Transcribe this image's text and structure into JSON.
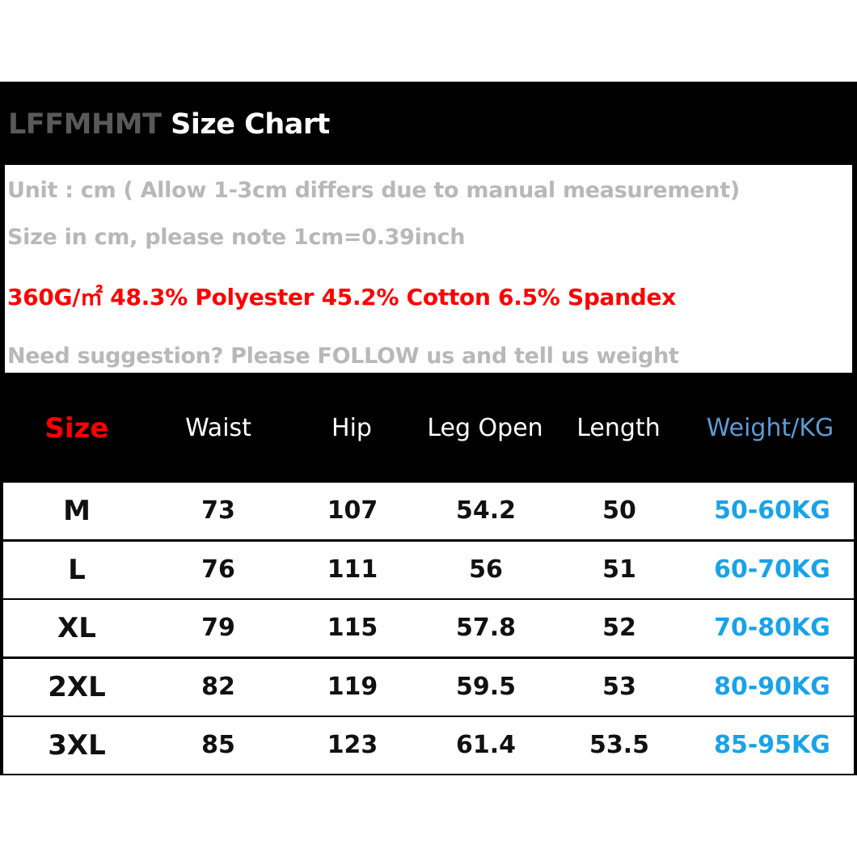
{
  "header": {
    "brand": "LFFMHMT",
    "title": "Size Chart"
  },
  "info": {
    "unit_note": "Unit : cm ( Allow 1-3cm differs due to manual measurement)",
    "conversion_note": "Size in cm, please note 1cm=0.39inch",
    "fabric_note": "360G/㎡ 48.3% Polyester 45.2% Cotton 6.5% Spandex",
    "suggestion_note": "Need suggestion? Please FOLLOW us and tell us weight"
  },
  "table": {
    "columns": [
      "Size",
      "Waist",
      "Hip",
      "Leg Open",
      "Length",
      "Weight/KG"
    ],
    "rows": [
      [
        "M",
        "73",
        "107",
        "54.2",
        "50",
        "50-60KG"
      ],
      [
        "L",
        "76",
        "111",
        "56",
        "51",
        "60-70KG"
      ],
      [
        "XL",
        "79",
        "115",
        "57.8",
        "52",
        "70-80KG"
      ],
      [
        "2XL",
        "82",
        "119",
        "59.5",
        "53",
        "80-90KG"
      ],
      [
        "3XL",
        "85",
        "123",
        "61.4",
        "53.5",
        "85-95KG"
      ]
    ]
  },
  "colors": {
    "size_header": "#ff0000",
    "weight_header": "#5b9bd5",
    "weight_values": "#1aa3e6",
    "fabric_note": "#ff0000",
    "notes": "#b8b8b8"
  }
}
